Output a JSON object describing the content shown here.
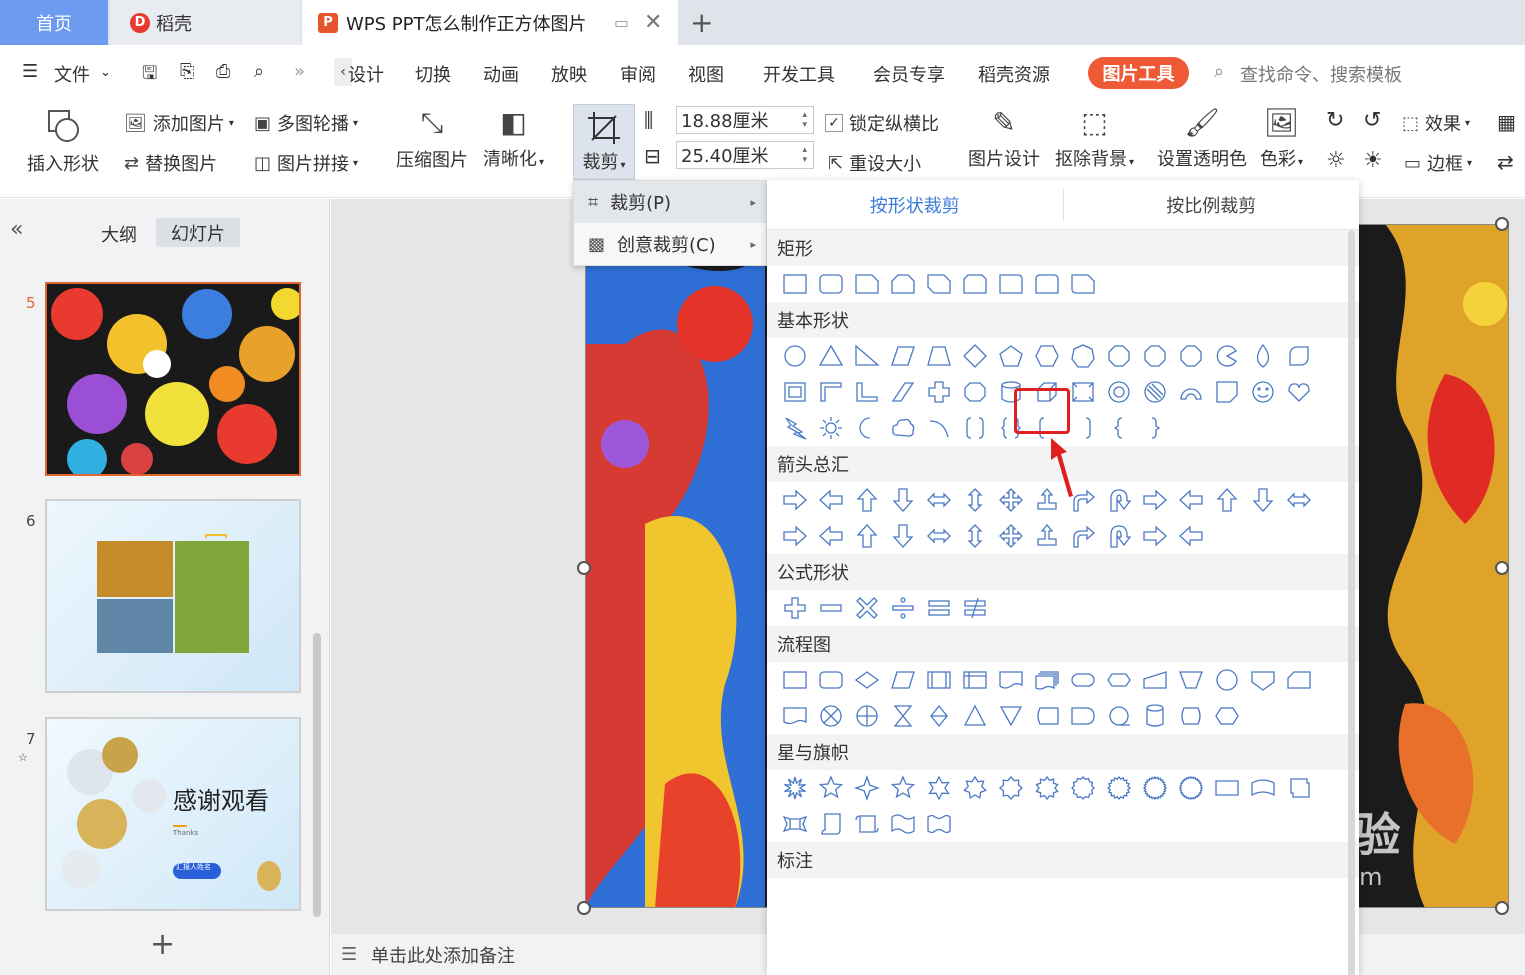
{
  "tabs": {
    "home": "首页",
    "daoke": "稻壳",
    "doc": "WPS PPT怎么制作正方体图片"
  },
  "menu": {
    "file": "文件",
    "items": [
      "设计",
      "切换",
      "动画",
      "放映",
      "审阅",
      "视图",
      "开发工具",
      "会员专享",
      "稻壳资源"
    ],
    "picture_tools": "图片工具",
    "search": "查找命令、搜索模板"
  },
  "ribbon": {
    "insert_shape": "插入形状",
    "add_picture": "添加图片",
    "multi_carousel": "多图轮播",
    "replace_picture": "替换图片",
    "picture_stitch": "图片拼接",
    "compress": "压缩图片",
    "sharpen": "清晰化",
    "crop": "裁剪",
    "height": "18.88厘米",
    "width": "25.40厘米",
    "lock_ratio": "锁定纵横比",
    "reset_size": "重设大小",
    "pic_design": "图片设计",
    "remove_bg": "抠除背景",
    "transparency": "设置透明色",
    "color": "色彩",
    "effect": "效果",
    "border": "边框"
  },
  "left_panel": {
    "outline": "大纲",
    "slides": "幻灯片",
    "slide_numbers": [
      "5",
      "6",
      "7"
    ],
    "slide7_title": "感谢观看",
    "slide7_sub": "Thanks",
    "slide7_badge": "汇报人姓名"
  },
  "notes": "单击此处添加备注",
  "crop_menu": {
    "crop": "裁剪(P)",
    "creative_crop": "创意裁剪(C)"
  },
  "shape_panel": {
    "tab_shape": "按形状裁剪",
    "tab_ratio": "按比例裁剪",
    "sections": {
      "rect": "矩形",
      "basic": "基本形状",
      "arrows": "箭头总汇",
      "formula": "公式形状",
      "flowchart": "流程图",
      "stars": "星与旗帜",
      "callouts": "标注"
    }
  },
  "watermark": {
    "brand": "Baidu经验",
    "url": "jingyan.baidu.com"
  },
  "colors": {
    "accent": "#3b7bdb",
    "picture_tools": "#ee5a35",
    "highlight": "#e02020",
    "home_tab": "#6d9bef"
  }
}
